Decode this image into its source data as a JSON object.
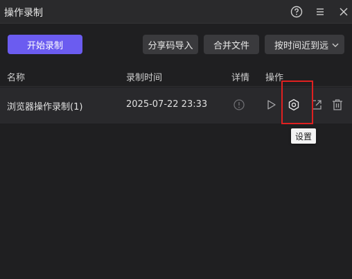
{
  "window": {
    "title": "操作录制"
  },
  "titlebar_icons": [
    "help-icon",
    "menu-icon",
    "close-icon"
  ],
  "toolbar": {
    "start_label": "开始录制",
    "share_import_label": "分享码导入",
    "merge_label": "合并文件",
    "sort_label": "按时间近到远"
  },
  "table": {
    "headers": {
      "name": "名称",
      "time": "录制时间",
      "detail": "详情",
      "ops": "操作"
    },
    "rows": [
      {
        "name": "浏览器操作录制(1)",
        "time": "2025-07-22 23:33",
        "actions": [
          "info-icon",
          "play-icon",
          "settings-icon",
          "export-icon",
          "delete-icon"
        ]
      }
    ]
  },
  "tooltip": {
    "text": "设置"
  },
  "colors": {
    "accent": "#6b5cf0",
    "highlight_box": "#e02020",
    "background": "#1f1f21",
    "row_bg": "#29292c"
  }
}
